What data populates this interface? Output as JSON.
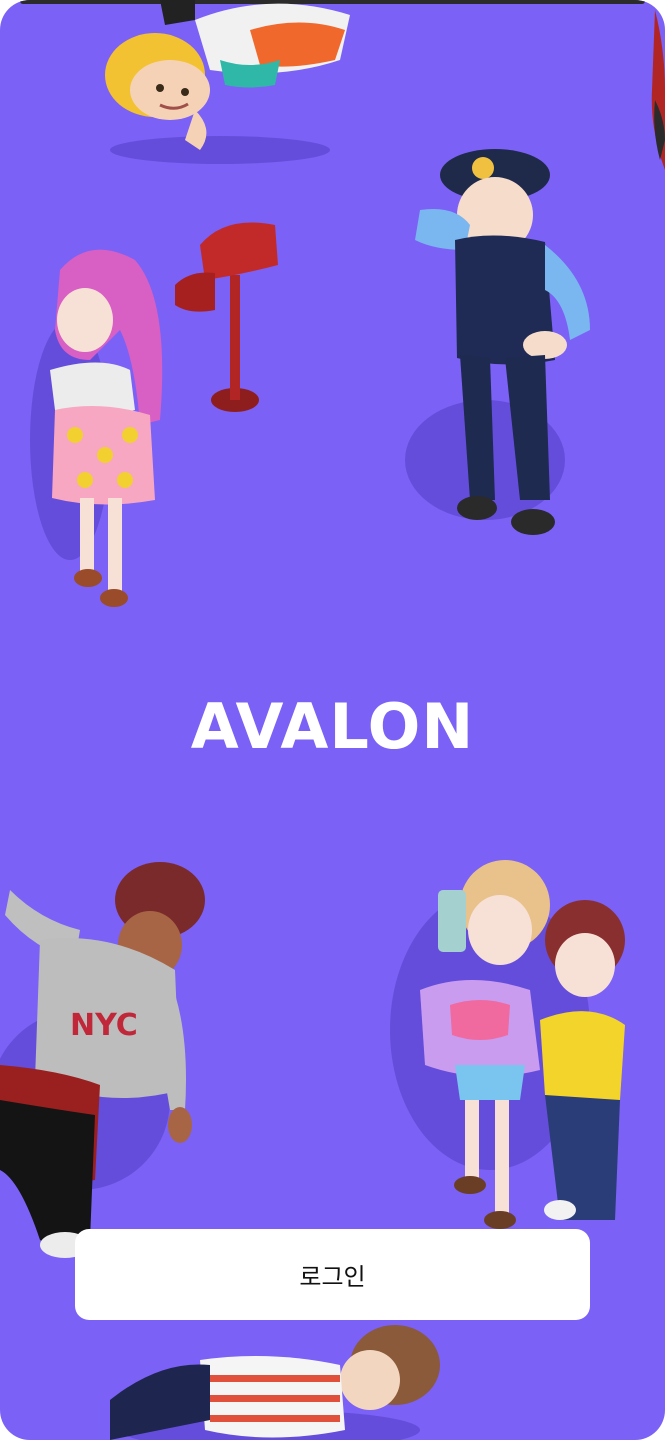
{
  "app": {
    "title": "AVALON"
  },
  "actions": {
    "login_label": "로그인"
  },
  "colors": {
    "background": "#7b61f6",
    "button_background": "#ffffff",
    "title_text": "#ffffff"
  },
  "illustrations": [
    "avatar-blonde-boy-icon",
    "avatar-police-officer-icon",
    "mailbox-icon",
    "avatar-pink-hair-girl-icon",
    "avatar-nyc-hoodie-boy-icon",
    "avatar-selfie-girls-icon",
    "avatar-striped-shirt-boy-icon"
  ]
}
